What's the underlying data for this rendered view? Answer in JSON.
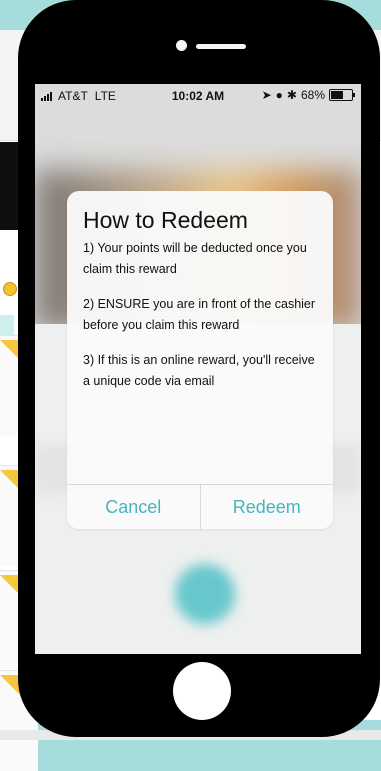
{
  "status_bar": {
    "carrier": "AT&T",
    "network": "LTE",
    "time": "10:02 AM",
    "battery": "68%",
    "battery_fraction": 0.68
  },
  "dialog": {
    "title": "How to Redeem",
    "steps": [
      "1) Your points will be deducted once you claim this reward",
      "2) ENSURE you are in front of the cashier before you claim this reward",
      "3) If this is an online reward, you'll receive a unique code via email"
    ],
    "cancel_label": "Cancel",
    "redeem_label": "Redeem"
  },
  "colors": {
    "accent": "#43b6c2",
    "background": "#a7dcdc"
  }
}
